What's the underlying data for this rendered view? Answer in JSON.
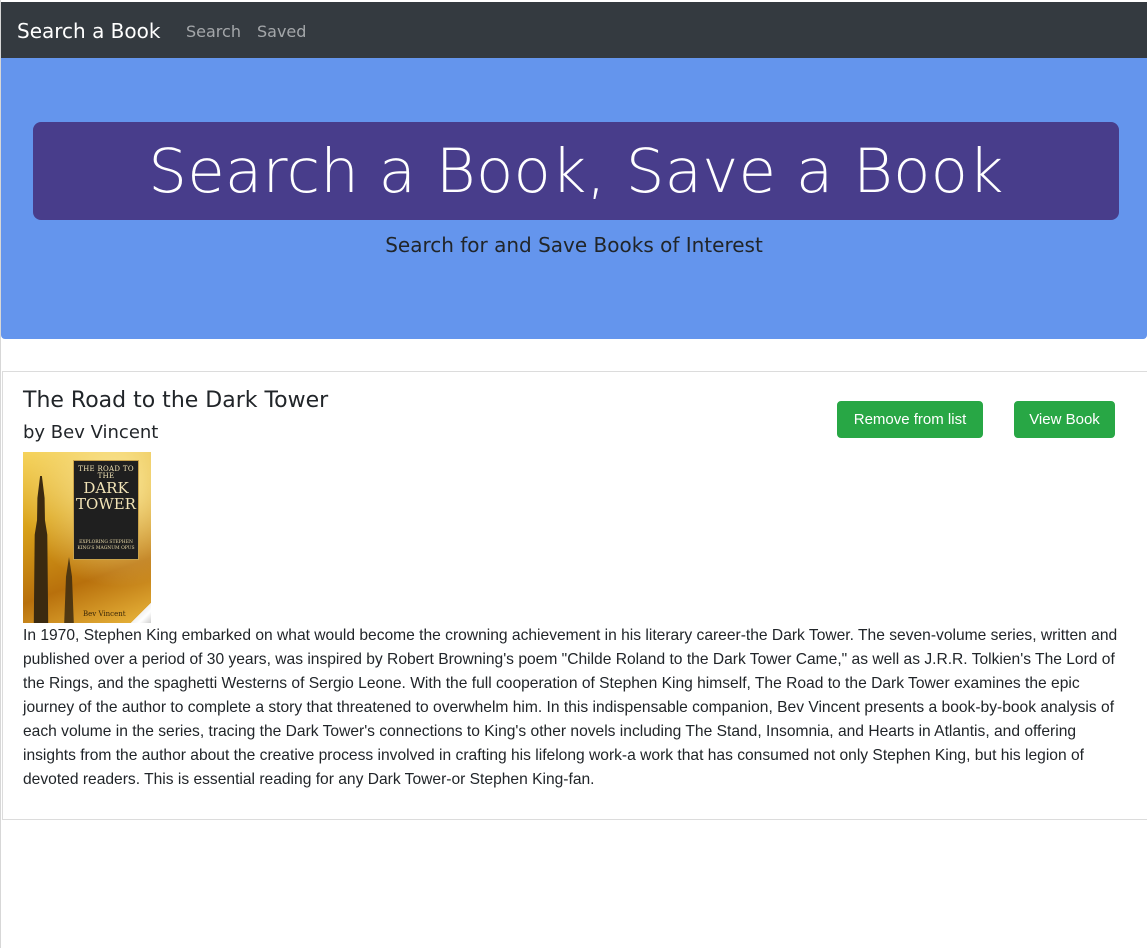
{
  "navbar": {
    "brand": "Search a Book",
    "links": [
      "Search",
      "Saved"
    ]
  },
  "jumbotron": {
    "title": "Search a Book, Save a Book",
    "subtitle": "Search for and Save Books of Interest"
  },
  "book": {
    "title": "The Road to the Dark Tower",
    "author": "by Bev Vincent",
    "buttons": {
      "remove": "Remove from list",
      "view": "View Book"
    },
    "cover": {
      "title_top": "THE ROAD TO",
      "title_mid": "THE",
      "title_big_1": "DARK",
      "title_big_2": "TOWER",
      "subtitle": "EXPLORING STEPHEN KING'S MAGNUM OPUS",
      "author": "Bev Vincent"
    },
    "description": "In 1970, Stephen King embarked on what would become the crowning achievement in his literary career-the Dark Tower. The seven-volume series, written and published over a period of 30 years, was inspired by Robert Browning's poem \"Childe Roland to the Dark Tower Came,\" as well as J.R.R. Tolkien's The Lord of the Rings, and the spaghetti Westerns of Sergio Leone. With the full cooperation of Stephen King himself, The Road to the Dark Tower examines the epic journey of the author to complete a story that threatened to overwhelm him. In this indispensable companion, Bev Vincent presents a book-by-book analysis of each volume in the series, tracing the Dark Tower's connections to King's other novels including The Stand, Insomnia, and Hearts in Atlantis, and offering insights from the author about the creative process involved in crafting his lifelong work-a work that has consumed not only Stephen King, but his legion of devoted readers. This is essential reading for any Dark Tower-or Stephen King-fan."
  },
  "colors": {
    "navbar_bg": "#343a40",
    "jumbotron_bg": "#6495ed",
    "title_box_bg": "#483d8b",
    "button_green": "#28a745"
  }
}
